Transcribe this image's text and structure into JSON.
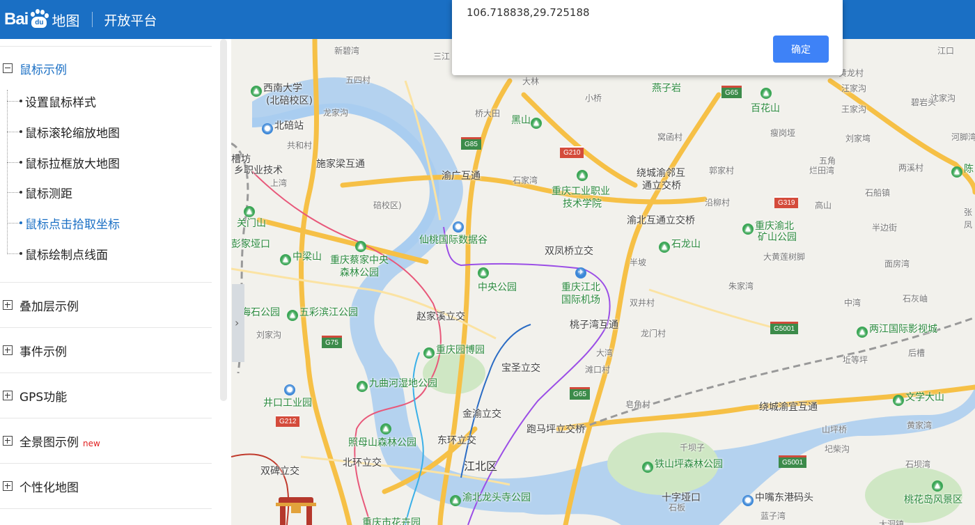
{
  "header": {
    "logo_bai": "Bai",
    "logo_du": "du",
    "logo_map": "地图",
    "platform": "开放平台"
  },
  "sidebar": {
    "groups": [
      {
        "label": "鼠标示例",
        "expanded": true
      },
      {
        "label": "叠加层示例"
      },
      {
        "label": "事件示例"
      },
      {
        "label": "GPS功能"
      },
      {
        "label": "全景图示例",
        "badge": "new"
      },
      {
        "label": "个性化地图"
      }
    ],
    "children": [
      "设置鼠标样式",
      "鼠标滚轮缩放地图",
      "鼠标拉框放大地图",
      "鼠标测距",
      "鼠标点击拾取坐标",
      "鼠标绘制点线面"
    ],
    "active_child": "鼠标点击拾取坐标"
  },
  "dialog": {
    "message": "106.718838,29.725188",
    "ok_label": "确定"
  },
  "map": {
    "labels": [
      "新碧湾",
      "三江",
      "五四村",
      "西南大学",
      "(北碚校区)",
      "龙家沟",
      "北碚站",
      "共和村",
      "施家梁互通",
      "上湾",
      "关门山",
      "彭家垭口",
      "中梁山",
      "重庆蔡家中央",
      "森林公园",
      "海石公园",
      "五彩滨江公园",
      "刘家沟",
      "井口工业园",
      "照母山森林公园",
      "九曲河湿地公园",
      "双碑立交",
      "北环立交",
      "东环立交",
      "江北区",
      "渝北龙头寺公园",
      "重庆市花卉园",
      "赵家溪立交",
      "重庆园博园",
      "金渝立交",
      "宝圣立交",
      "仙桃国际数据谷",
      "中央公园",
      "重庆江北",
      "国际机场",
      "双凤桥立交",
      "桃子湾互通",
      "跑马坪立交桥",
      "铁山坪森林公园",
      "十字垭口",
      "中嘴东港码头",
      "黑山",
      "渝广互通",
      "石家湾",
      "重庆工业职业",
      "技术学院",
      "燕子岩",
      "小桥",
      "桥大田",
      "绕城渝邻互",
      "通立交桥",
      "渝北互通立交桥",
      "石龙山",
      "百花山",
      "窝函村",
      "郭家村",
      "瘦岗垭",
      "刘家塆",
      "两溪村",
      "石船镇",
      "重庆渝北",
      "矿山公园",
      "大黄莲树脚",
      "面房湾",
      "朱家湾",
      "中湾",
      "石灰岫",
      "两江国际影视城",
      "后槽",
      "坵等坪",
      "绕城渝宜互通",
      "文学大山",
      "黄家湾",
      "山坪桥",
      "圮柴沟",
      "石坝湾",
      "桃花岛风景区",
      "王家沟",
      "沈家沟",
      "河脚湾",
      "五角",
      "半边街",
      "高山",
      "碧岩头",
      "汪家沟",
      "江口",
      "黄龙村",
      "大林",
      "半坡",
      "双井村",
      "龙门村",
      "大湾",
      "滩口村",
      "皂角村",
      "石板",
      "蓝子湾",
      "千坝子",
      "大洞镇",
      "烂田湾",
      "槽坊",
      "乡职业技术",
      "碚校区)",
      "沿柳村",
      "陈",
      "张",
      "凤"
    ],
    "shields": [
      "G85",
      "G210",
      "G65",
      "G319",
      "G75",
      "G5001",
      "G65",
      "G212",
      "G5001"
    ]
  }
}
